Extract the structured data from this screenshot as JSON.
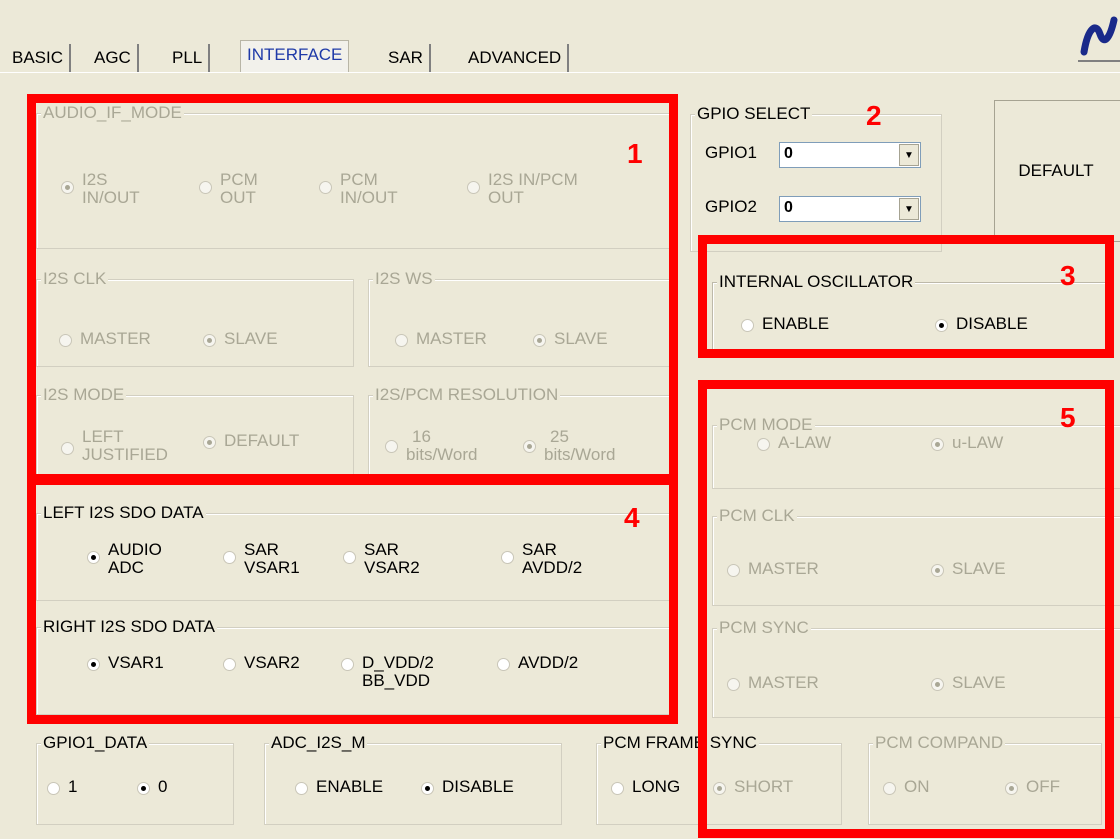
{
  "tabs": [
    "BASIC",
    "AGC",
    "PLL",
    "INTERFACE",
    "SAR",
    "ADVANCED"
  ],
  "logo": "ℵ",
  "audio_if_mode": {
    "title": "AUDIO_IF_MODE",
    "opt1a": "I2S",
    "opt1b": "IN/OUT",
    "opt2a": "PCM",
    "opt2b": "OUT",
    "opt3a": "PCM",
    "opt3b": "IN/OUT",
    "opt4a": "I2S IN/PCM",
    "opt4b": "OUT"
  },
  "i2s_clk": {
    "title": "I2S CLK",
    "master": "MASTER",
    "slave": "SLAVE"
  },
  "i2s_ws": {
    "title": "I2S WS",
    "master": "MASTER",
    "slave": "SLAVE"
  },
  "i2s_mode": {
    "title": "I2S MODE",
    "opt1a": "LEFT",
    "opt1b": "JUSTIFIED",
    "opt2": "DEFAULT"
  },
  "i2s_res": {
    "title": "I2S/PCM RESOLUTION",
    "opt1a": "16",
    "opt1b": "bits/Word",
    "opt2a": "25",
    "opt2b": "bits/Word"
  },
  "left_sdo": {
    "title": "LEFT I2S SDO DATA",
    "opt1a": "AUDIO",
    "opt1b": "ADC",
    "opt2a": "SAR",
    "opt2b": "VSAR1",
    "opt3a": "SAR",
    "opt3b": "VSAR2",
    "opt4a": "SAR",
    "opt4b": "AVDD/2"
  },
  "right_sdo": {
    "title": "RIGHT I2S SDO DATA",
    "opt1": "VSAR1",
    "opt2": "VSAR2",
    "opt3a": "D_VDD/2",
    "opt3b": "BB_VDD",
    "opt4": "AVDD/2"
  },
  "gpio_select": {
    "title": "GPIO SELECT",
    "gpio1_label": "GPIO1",
    "gpio1_value": "0",
    "gpio2_label": "GPIO2",
    "gpio2_value": "0"
  },
  "default_button": "DEFAULT",
  "internal_osc": {
    "title": "INTERNAL OSCILLATOR",
    "enable": "ENABLE",
    "disable": "DISABLE"
  },
  "pcm_mode": {
    "title": "PCM MODE",
    "opt1": "A-LAW",
    "opt2": "u-LAW"
  },
  "pcm_clk": {
    "title": "PCM CLK",
    "master": "MASTER",
    "slave": "SLAVE"
  },
  "pcm_sync": {
    "title": "PCM SYNC",
    "master": "MASTER",
    "slave": "SLAVE"
  },
  "gpio1_data": {
    "title": "GPIO1_DATA",
    "opt1": "1",
    "opt2": "0"
  },
  "adc_i2s_m": {
    "title": "ADC_I2S_M",
    "enable": "ENABLE",
    "disable": "DISABLE"
  },
  "pcm_frame_sync": {
    "title": "PCM FRAME SYNC",
    "long": "LONG",
    "short": "SHORT"
  },
  "pcm_compand": {
    "title": "PCM COMPAND",
    "on": "ON",
    "off": "OFF"
  },
  "annotations": {
    "n1": "1",
    "n2": "2",
    "n3": "3",
    "n4": "4",
    "n5": "5"
  },
  "colors": {
    "highlight": "#ff0000",
    "background": "#ece9d8",
    "active_tab": "#1f3aa8"
  }
}
